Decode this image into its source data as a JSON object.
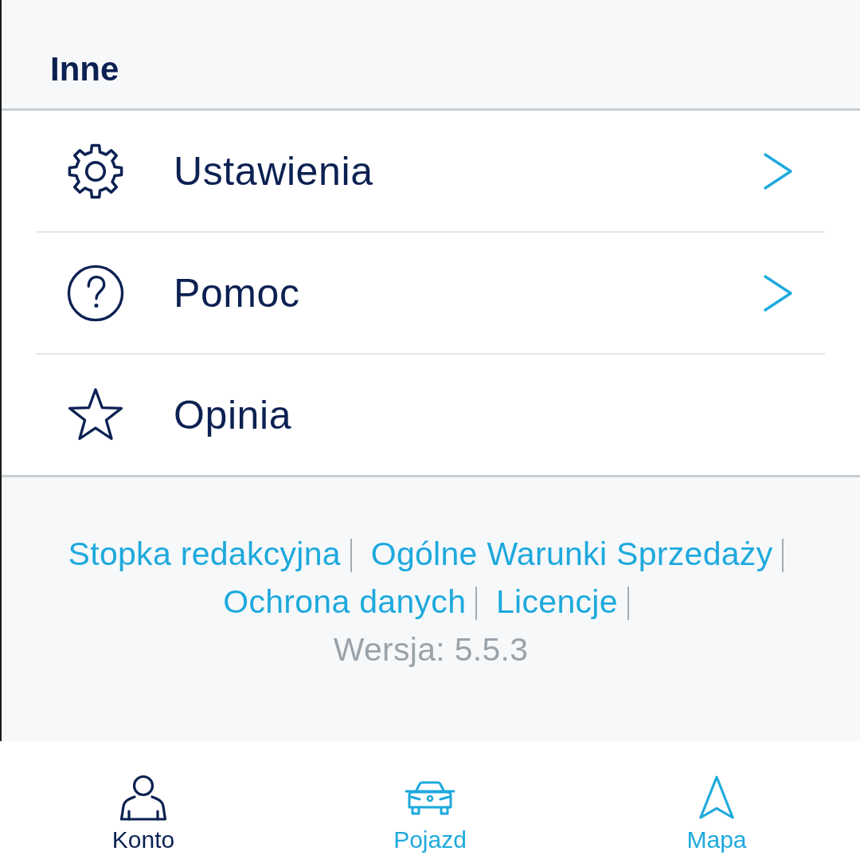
{
  "header": {
    "title": "Inne"
  },
  "menu": {
    "items": [
      {
        "label": "Ustawienia",
        "chevron": true
      },
      {
        "label": "Pomoc",
        "chevron": true
      },
      {
        "label": "Opinia",
        "chevron": false
      }
    ]
  },
  "footer": {
    "links": [
      "Stopka redakcyjna",
      "Ogólne Warunki Sprzedaży",
      "Ochrona danych",
      "Licencje"
    ],
    "version": "Wersja: 5.5.3"
  },
  "nav": {
    "items": [
      {
        "label": "Konto",
        "selected": true
      },
      {
        "label": "Pojazd",
        "selected": false
      },
      {
        "label": "Mapa",
        "selected": false
      }
    ]
  }
}
